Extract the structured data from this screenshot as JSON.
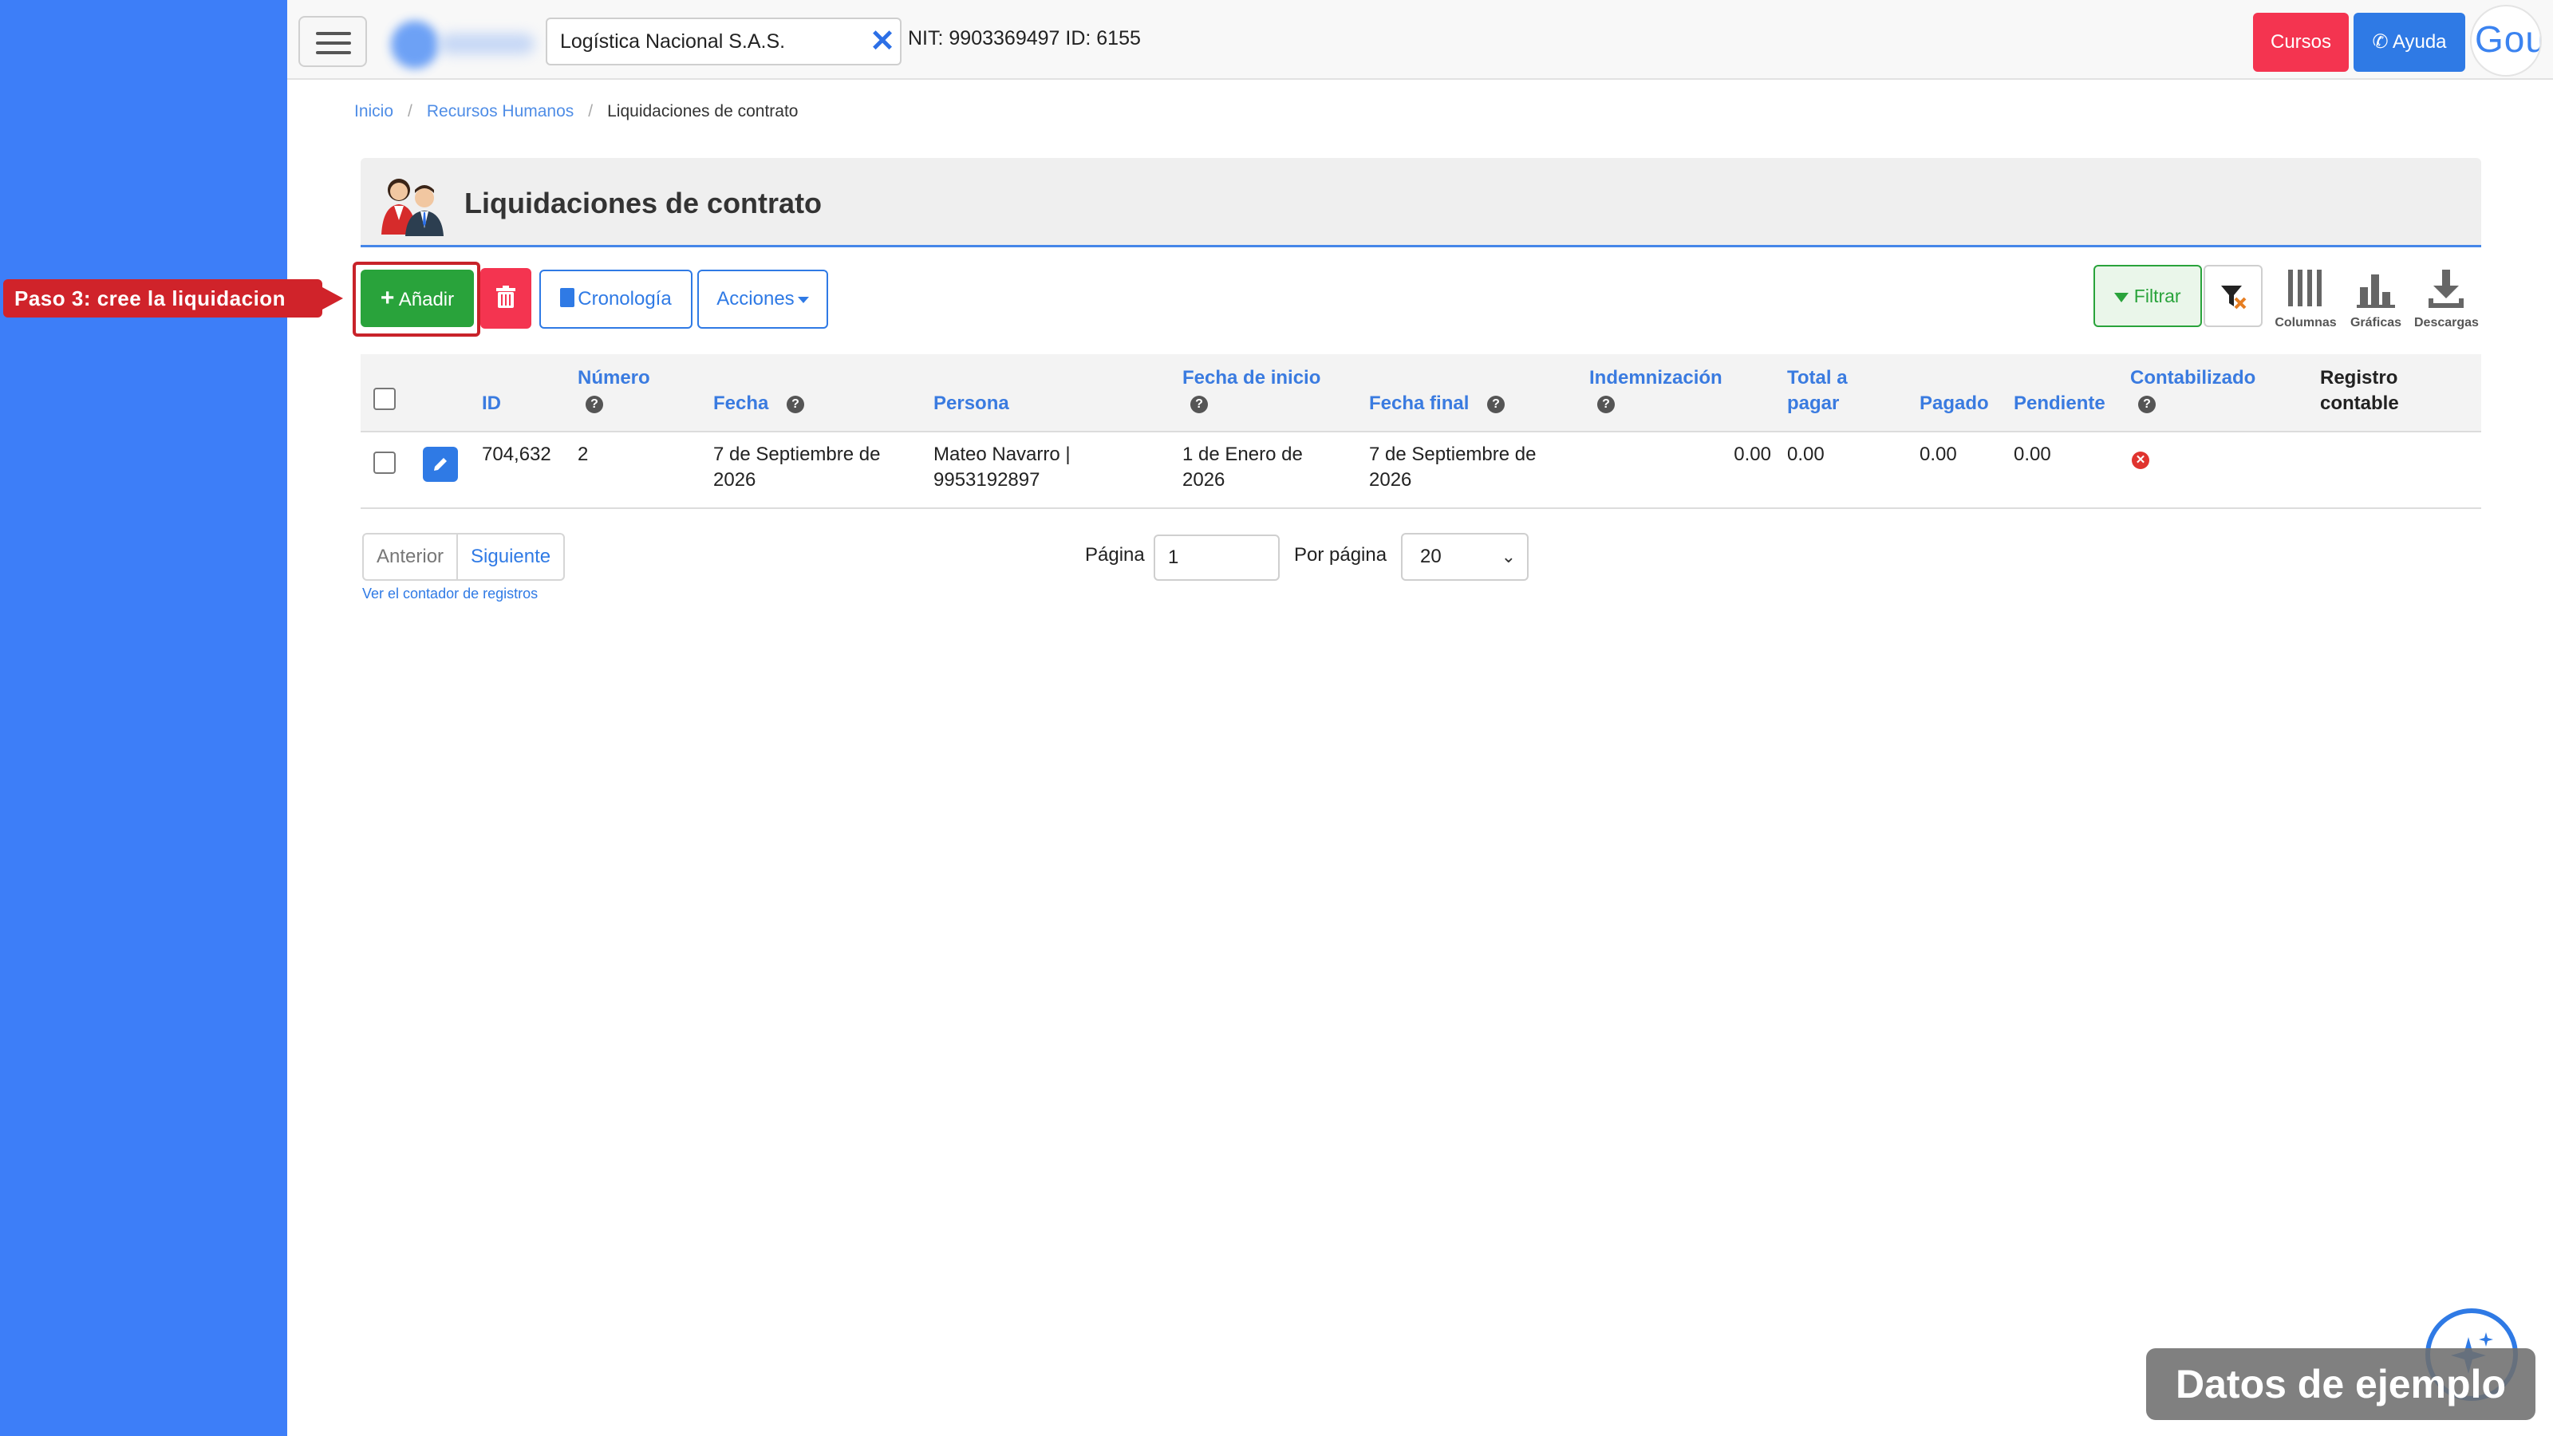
{
  "navbar": {
    "company_name": "Logística Nacional S.A.S.",
    "nit_text": "NIT: 9903369497 ID: 6155",
    "cursos_label": "Cursos",
    "ayuda_label": "Ayuda",
    "avatar_text": "Gou"
  },
  "breadcrumb": [
    "Inicio",
    "Recursos Humanos",
    "Liquidaciones de contrato"
  ],
  "page": {
    "title": "Liquidaciones de contrato"
  },
  "callout": {
    "text": "Paso 3: cree la liquidacion"
  },
  "toolbar": {
    "add_label": "Añadir",
    "cronologia_label": "Cronología",
    "acciones_label": "Acciones",
    "filtrar_label": "Filtrar",
    "columnas_label": "Columnas",
    "graficas_label": "Gráficas",
    "descargas_label": "Descargas"
  },
  "table": {
    "headers": {
      "id": "ID",
      "numero": "Número",
      "fecha": "Fecha",
      "persona": "Persona",
      "fecha_inicio": "Fecha de inicio",
      "fecha_final": "Fecha final",
      "indemnizacion": "Indemnización",
      "total_a": "Total a",
      "total_b": "pagar",
      "pagado": "Pagado",
      "pendiente": "Pendiente",
      "contabilizado": "Contabilizado",
      "registro_a": "Registro",
      "registro_b": "contable"
    },
    "rows": [
      {
        "id": "704,632",
        "numero": "2",
        "fecha_a": "7 de Septiembre de",
        "fecha_b": "2026",
        "persona_a": "Mateo Navarro |",
        "persona_b": "9953192897",
        "inicio_a": "1 de Enero de",
        "inicio_b": "2026",
        "final_a": "7 de Septiembre de",
        "final_b": "2026",
        "indemnizacion": "0.00",
        "total": "0.00",
        "pagado": "0.00",
        "pendiente": "0.00",
        "contabilizado": "no"
      }
    ]
  },
  "pagination": {
    "prev_label": "Anterior",
    "next_label": "Siguiente",
    "counter_link": "Ver el contador de registros",
    "page_label": "Página",
    "page_value": "1",
    "per_page_label": "Por página",
    "per_page_value": "20"
  },
  "badge": {
    "text": "Datos de ejemplo"
  },
  "colors": {
    "sidebar": "#3d7ef8",
    "primary": "#2f7ae5",
    "success": "#29a33b",
    "danger": "#f43450",
    "callout": "#d0232a"
  },
  "icons": [
    "menu-icon",
    "close-icon",
    "whatsapp-icon",
    "people-icon",
    "plus-icon",
    "trash-icon",
    "book-icon",
    "filter-icon",
    "clear-filter-icon",
    "columns-icon",
    "chart-icon",
    "download-icon",
    "question-icon",
    "pencil-icon",
    "error-circle-icon",
    "sparkle-icon"
  ]
}
